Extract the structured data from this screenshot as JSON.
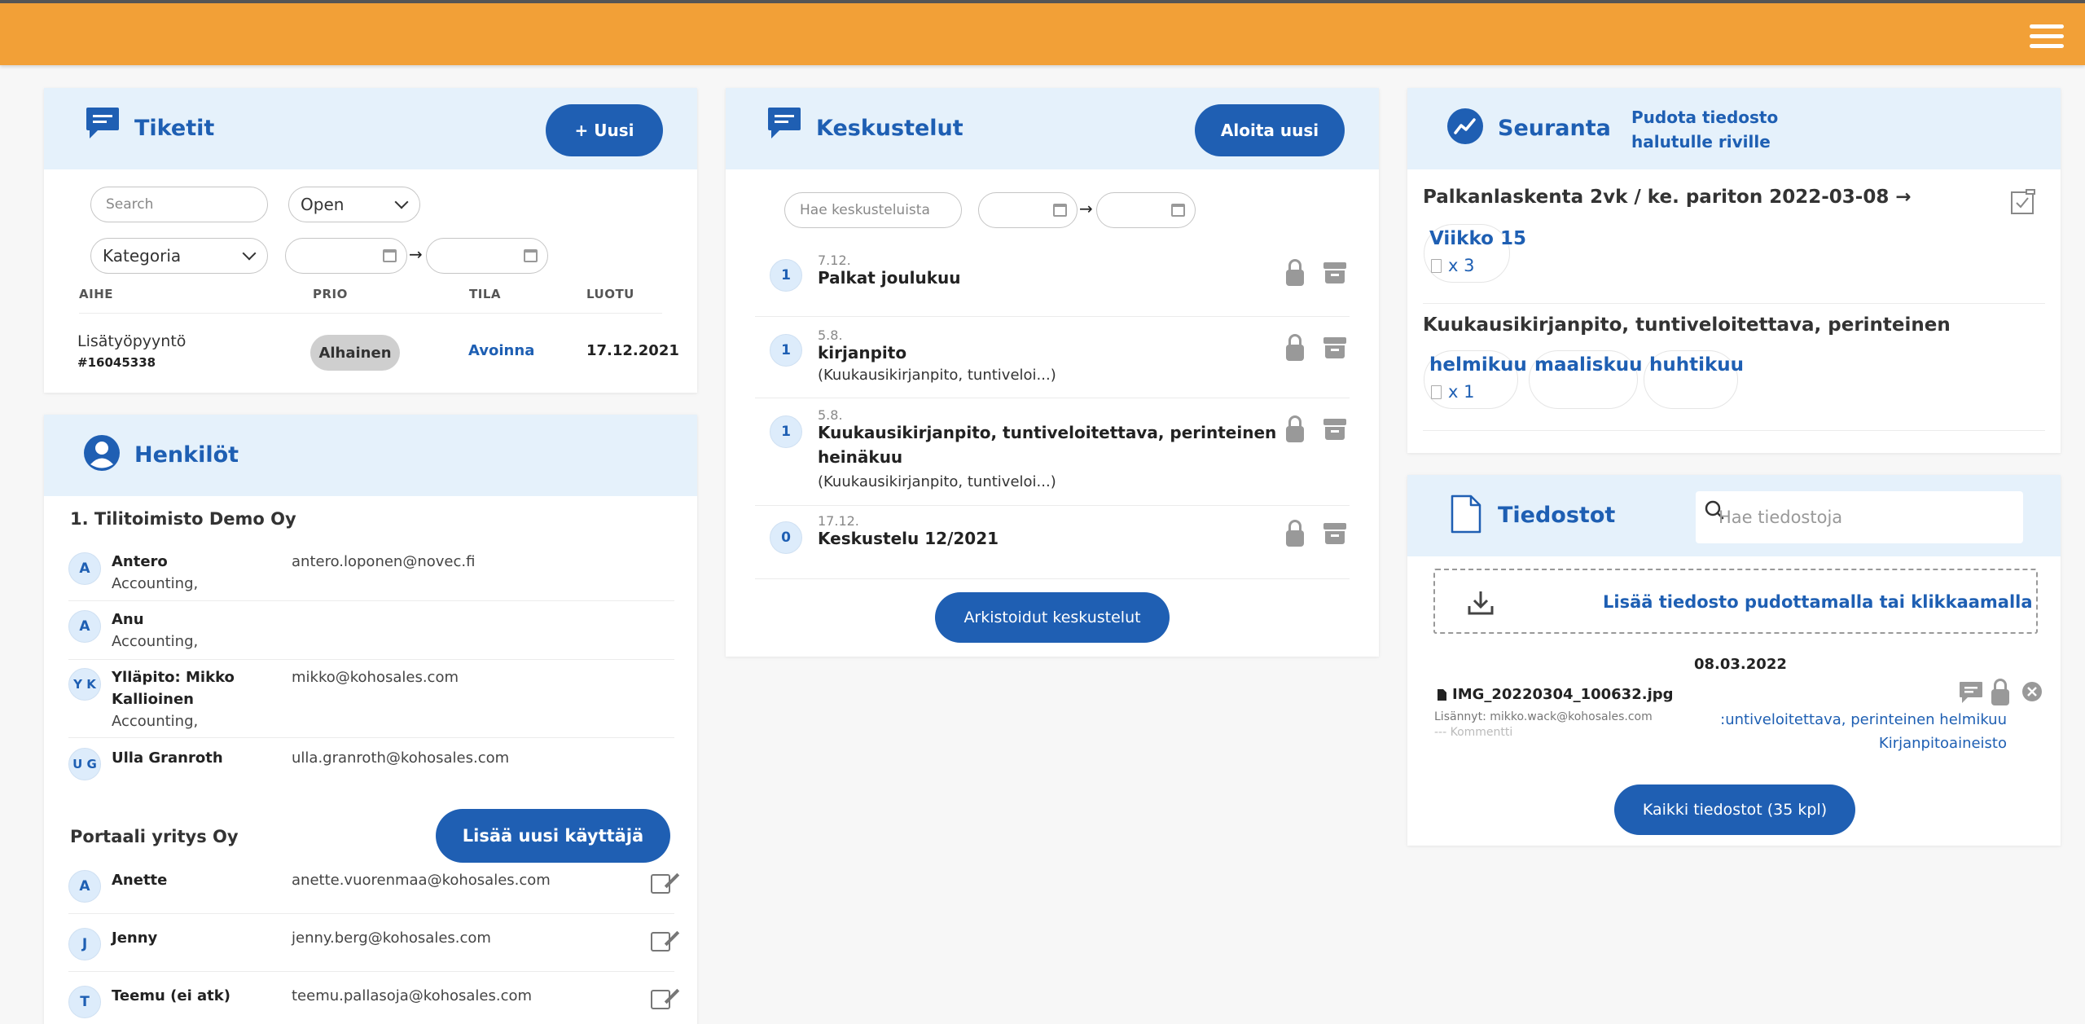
{
  "tickets": {
    "title": "Tiketit",
    "new_button": "+ Uusi",
    "search_placeholder": "Search",
    "status_select": "Open",
    "category_select": "Kategoria",
    "columns": [
      "AIHE",
      "PRIO",
      "TILA",
      "LUOTU"
    ],
    "rows": [
      {
        "subject": "Lisätyöpyyntö",
        "id": "#16045338",
        "priority": "Alhainen",
        "status": "Avoinna",
        "created": "17.12.2021"
      }
    ]
  },
  "people": {
    "title": "Henkilöt",
    "groups": [
      {
        "company": "1. Tilitoimisto Demo Oy",
        "members": [
          {
            "initials": "A",
            "name": "Antero",
            "name2": "",
            "role": "Accounting,",
            "email": "antero.loponen@novec.fi"
          },
          {
            "initials": "A",
            "name": "Anu",
            "name2": "",
            "role": "Accounting,",
            "email": ""
          },
          {
            "initials": "Y K",
            "name": "Ylläpito: Mikko",
            "name2": "Kallioinen",
            "role": "Accounting,",
            "email": "mikko@kohosales.com"
          },
          {
            "initials": "U G",
            "name": "Ulla Granroth",
            "name2": "",
            "role": "",
            "email": "ulla.granroth@kohosales.com"
          }
        ]
      },
      {
        "company": "Portaali yritys Oy",
        "add_button": "Lisää uusi käyttäjä",
        "members": [
          {
            "initials": "A",
            "name": "Anette",
            "email": "anette.vuorenmaa@kohosales.com"
          },
          {
            "initials": "J",
            "name": "Jenny",
            "email": "jenny.berg@kohosales.com"
          },
          {
            "initials": "T",
            "name": "Teemu (ei atk)",
            "email": "teemu.pallasoja@kohosales.com"
          }
        ]
      }
    ]
  },
  "discussions": {
    "title": "Keskustelut",
    "new_button": "Aloita uusi",
    "search_placeholder": "Hae keskusteluista",
    "items": [
      {
        "count": "1",
        "date": "7.12.",
        "title": "Palkat joulukuu",
        "title2": "",
        "sub": ""
      },
      {
        "count": "1",
        "date": "5.8.",
        "title": "kirjanpito",
        "title2": "",
        "sub": "(Kuukausikirjanpito, tuntiveloi...)"
      },
      {
        "count": "1",
        "date": "5.8.",
        "title": "Kuukausikirjanpito, tuntiveloitettava, perinteinen",
        "title2": "heinäkuu",
        "sub": "(Kuukausikirjanpito, tuntiveloi...)"
      },
      {
        "count": "0",
        "date": "17.12.",
        "title": "Keskustelu 12/2021",
        "title2": "",
        "sub": ""
      }
    ],
    "archived_button": "Arkistoidut keskustelut"
  },
  "tracking": {
    "title": "Seuranta",
    "hint_line1": "Pudota tiedosto",
    "hint_line2": "halutulle riville",
    "sections": [
      {
        "heading": "Palkanlaskenta 2vk / ke. pariton 2022-03-08 →",
        "chips": [
          {
            "label": "Viikko 15",
            "count": "x 3"
          }
        ]
      },
      {
        "heading": "Kuukausikirjanpito, tuntiveloitettava, perinteinen",
        "chips": [
          {
            "label": "helmikuu",
            "count": "x 1"
          },
          {
            "label": "maaliskuu",
            "count": ""
          },
          {
            "label": "huhtikuu",
            "count": ""
          }
        ]
      }
    ]
  },
  "files": {
    "title": "Tiedostot",
    "search_placeholder": "Hae tiedostoja",
    "dropzone": "Lisää tiedosto pudottamalla tai klikkaamalla",
    "date_group": "08.03.2022",
    "file": {
      "name": "IMG_20220304_100632.jpg",
      "added_by": "Lisännyt: mikko.wack@kohosales.com",
      "comment": "--- Kommentti",
      "tag1": ":untiveloitettava, perinteinen helmikuu",
      "tag2": "Kirjanpitoaineisto"
    },
    "all_button": "Kaikki tiedostot (35 kpl)"
  },
  "colors": {
    "topbar": "#f2a037",
    "accent": "#1f5fb3",
    "header_bg": "#e5f1fb"
  },
  "icons": [
    "menu-icon",
    "chat-icon",
    "person-icon",
    "chart-icon",
    "document-icon",
    "search-icon",
    "download-icon",
    "calendar-icon",
    "lock-icon",
    "archive-icon",
    "edit-icon",
    "comment-icon",
    "close-icon",
    "file-icon"
  ]
}
